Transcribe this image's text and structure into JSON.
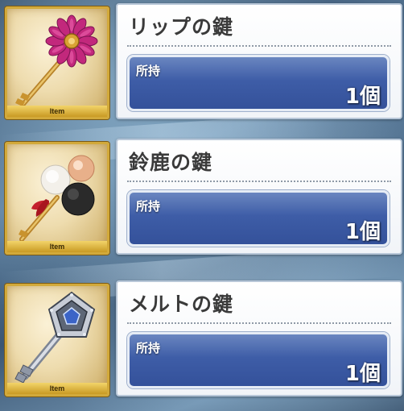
{
  "items": [
    {
      "name": "リップの鍵",
      "qty_label": "所持",
      "qty_value": "1個",
      "tag": "Item",
      "icon": "flower-key-icon"
    },
    {
      "name": "鈴鹿の鍵",
      "qty_label": "所持",
      "qty_value": "1個",
      "tag": "Item",
      "icon": "pompom-key-icon"
    },
    {
      "name": "メルトの鍵",
      "qty_label": "所持",
      "qty_value": "1個",
      "tag": "Item",
      "icon": "pentagon-key-icon"
    }
  ],
  "colors": {
    "frame_gold": "#d2a93a",
    "qty_box_blue": "#3e5da7",
    "panel_white": "#f1f4f8"
  }
}
